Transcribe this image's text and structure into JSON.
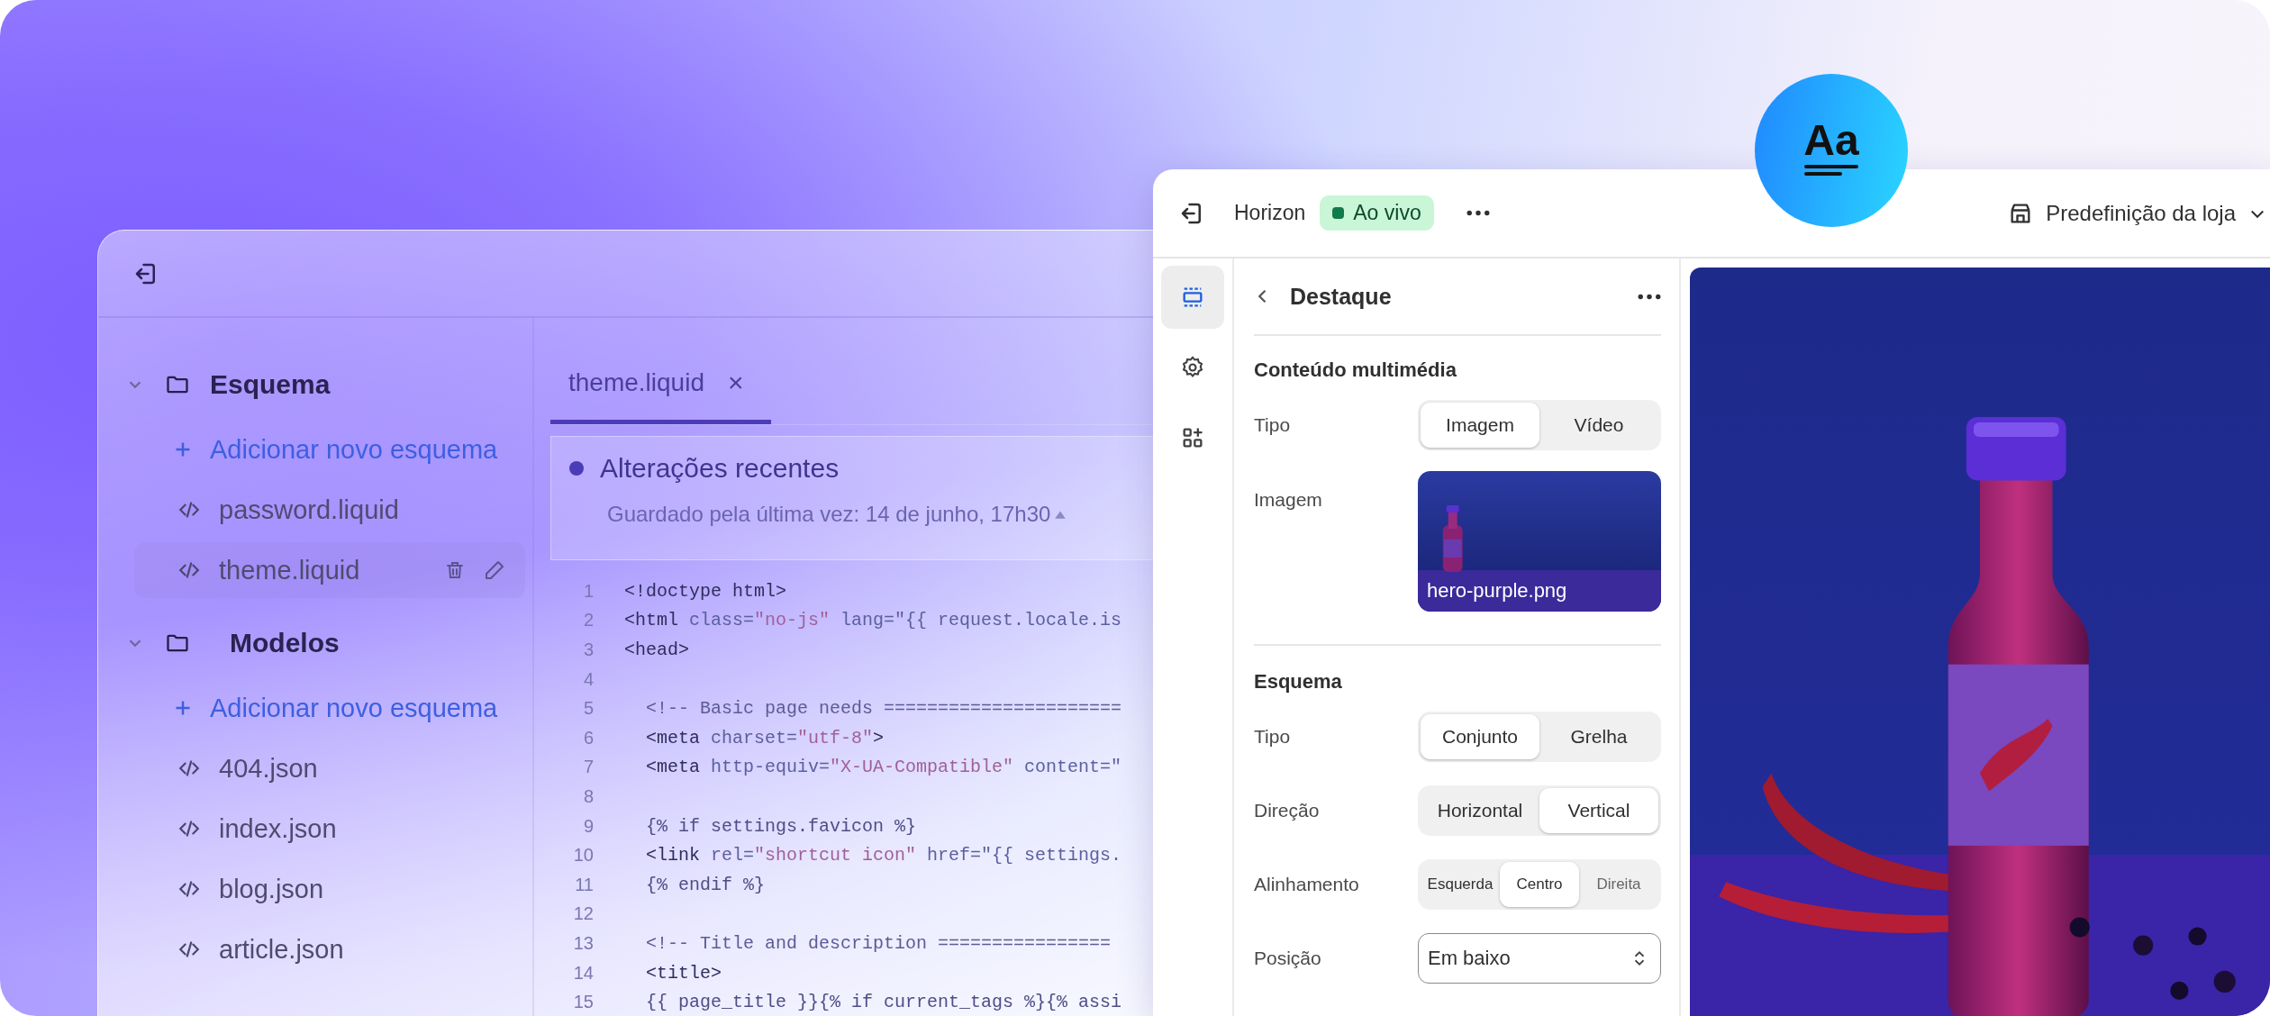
{
  "sidebar": {
    "folders": [
      {
        "name": "Esquema",
        "expanded": true,
        "add_label": "Adicionar novo esquema",
        "children": [
          {
            "name": "password.liquid",
            "selected": false
          },
          {
            "name": "theme.liquid",
            "selected": true
          }
        ]
      },
      {
        "name": "Modelos",
        "expanded": true,
        "add_label": "Adicionar novo esquema",
        "children": [
          {
            "name": "404.json",
            "selected": false
          },
          {
            "name": "index.json",
            "selected": false
          },
          {
            "name": "blog.json",
            "selected": false
          },
          {
            "name": "article.json",
            "selected": false
          }
        ]
      }
    ]
  },
  "editor": {
    "tab": {
      "label": "theme.liquid",
      "close": "×"
    },
    "recent": {
      "title": "Alterações recentes",
      "saved": "Guardado pela última vez: 14 de junho, 17h30"
    },
    "code_lines": [
      {
        "number": "1",
        "tokens": [
          {
            "kind": "tag",
            "text": "<!doctype html>"
          }
        ]
      },
      {
        "number": "2",
        "tokens": [
          {
            "kind": "tag",
            "text": "<html "
          },
          {
            "kind": "attr",
            "text": "class="
          },
          {
            "kind": "str",
            "text": "\"no-js\""
          },
          {
            "kind": "attr",
            "text": " lang=\"{{ request.locale.is"
          }
        ]
      },
      {
        "number": "3",
        "tokens": [
          {
            "kind": "tag",
            "text": "<head>"
          }
        ]
      },
      {
        "number": "4"
      },
      {
        "number": "5",
        "tokens": [
          {
            "kind": "comment",
            "text": "  <!-- Basic page needs ======================"
          }
        ]
      },
      {
        "number": "6",
        "tokens": [
          {
            "kind": "tag",
            "text": "  <meta "
          },
          {
            "kind": "attr",
            "text": "charset="
          },
          {
            "kind": "str",
            "text": "\"utf-8\""
          },
          {
            "kind": "tag",
            "text": ">"
          }
        ]
      },
      {
        "number": "7",
        "tokens": [
          {
            "kind": "tag",
            "text": "  <meta "
          },
          {
            "kind": "attr",
            "text": "http-equiv="
          },
          {
            "kind": "str",
            "text": "\"X-UA-Compatible\""
          },
          {
            "kind": "attr",
            "text": " content=\""
          }
        ]
      },
      {
        "number": "8"
      },
      {
        "number": "9",
        "tokens": [
          {
            "kind": "liquid",
            "text": "  {% if settings.favicon %}"
          }
        ]
      },
      {
        "number": "10",
        "tokens": [
          {
            "kind": "tag",
            "text": "  <link "
          },
          {
            "kind": "attr",
            "text": "rel="
          },
          {
            "kind": "str",
            "text": "\"shortcut icon\""
          },
          {
            "kind": "attr",
            "text": " href=\"{{ settings."
          }
        ]
      },
      {
        "number": "11",
        "tokens": [
          {
            "kind": "liquid",
            "text": "  {% endif %}"
          }
        ]
      },
      {
        "number": "12"
      },
      {
        "number": "13",
        "tokens": [
          {
            "kind": "comment",
            "text": "  <!-- Title and description ================"
          }
        ]
      },
      {
        "number": "14",
        "tokens": [
          {
            "kind": "tag",
            "text": "  <title>"
          }
        ]
      },
      {
        "number": "15",
        "tokens": [
          {
            "kind": "liquid",
            "text": "  {{ page_title }}{% if current_tags %}{% assi"
          }
        ]
      }
    ]
  },
  "font_badge": {
    "label": "Aa"
  },
  "topbar": {
    "theme": "Horizon",
    "status": "Ao vivo",
    "store": "Predefinição da loja"
  },
  "rail": [
    {
      "kind": "sections",
      "selected": true
    },
    {
      "kind": "settings",
      "selected": false
    },
    {
      "kind": "apps",
      "selected": false
    }
  ],
  "panel": {
    "title": "Destaque",
    "sections": [
      {
        "heading": "Conteúdo multimédia",
        "rows": [
          {
            "kind": "segmented",
            "label": "Tipo",
            "options": [
              {
                "label": "Imagem",
                "selected": true
              },
              {
                "label": "Vídeo",
                "selected": false
              }
            ]
          },
          {
            "label": "Imagem",
            "filename": "hero-purple.png"
          }
        ]
      },
      {
        "heading": "Esquema",
        "rows": [
          {
            "kind": "segmented",
            "label": "Tipo",
            "options": [
              {
                "label": "Conjunto",
                "selected": true
              },
              {
                "label": "Grelha",
                "selected": false
              }
            ]
          },
          {
            "kind": "segmented",
            "label": "Direção",
            "options": [
              {
                "label": "Horizontal",
                "selected": false
              },
              {
                "label": "Vertical",
                "selected": true
              }
            ]
          },
          {
            "kind": "segmented",
            "label": "Alinhamento",
            "options": [
              {
                "label": "Esquerda",
                "selected": false
              },
              {
                "label": "Centro",
                "selected": true
              },
              {
                "label": "Direita",
                "selected": false
              }
            ]
          },
          {
            "kind": "select",
            "label": "Posição",
            "value": "Em baixo"
          }
        ]
      }
    ]
  }
}
